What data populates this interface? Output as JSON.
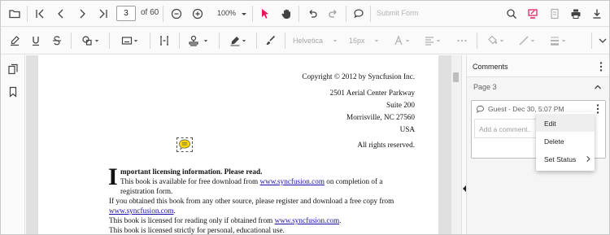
{
  "toolbar": {
    "page_number": "3",
    "page_count_label": "of 60",
    "zoom_label": "100%",
    "submit_form_label": "Submit Form"
  },
  "annotation_toolbar": {
    "font_family_label": "Helvetica",
    "font_size_label": "16px"
  },
  "document": {
    "copyright": "Copyright © 2012 by Syncfusion Inc.",
    "address_line1": "2501 Aerial Center Parkway",
    "address_line2": "Suite 200",
    "address_line3": "Morrisville, NC 27560",
    "address_line4": "USA",
    "rights": "All rights reserved.",
    "dropcap": "I",
    "notice_heading": "mportant licensing information. Please read.",
    "para1_a": "This book is available for free download from ",
    "para1_link": "www.syncfusion.com",
    "para1_b": " on completion of a",
    "para1_c": "registration form.",
    "para2_a": "If you obtained this book from any other source, please register and download a free copy from",
    "para2_link": "www.syncfusion.com",
    "para2_b": ".",
    "para3_a": "This book is licensed for reading only if obtained from ",
    "para3_link": "www.syncfusion.com",
    "para3_b": ".",
    "para4": "This book is licensed strictly for personal, educational use."
  },
  "comments_panel": {
    "title": "Comments",
    "page_group_label": "Page 3",
    "comment": {
      "author_line": "Guest - Dec 30, 5:07 PM",
      "reply_placeholder": "Add a comment.."
    },
    "context_menu": {
      "items": [
        "Edit",
        "Delete",
        "Set Status"
      ]
    }
  },
  "colors": {
    "accent": "#e3165b",
    "link": "#1a0dab",
    "sticky_note": "#ffd600"
  }
}
